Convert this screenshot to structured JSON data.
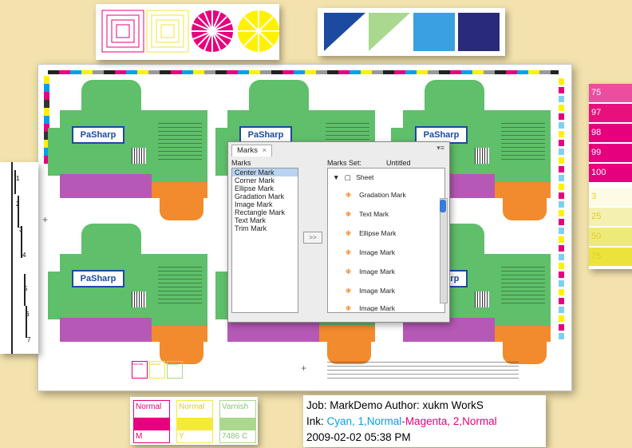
{
  "sheet": {
    "logo_text": "PaSharp",
    "bottom_legend_small": [
      "Normal",
      "Normal",
      "Varnish"
    ]
  },
  "dialog": {
    "tab_label": "Marks",
    "close_glyph": "×",
    "marks_label": "Marks",
    "marks_set_label": "Marks Set:",
    "marks_set_value": "Untitled",
    "move_button": ">>",
    "marks_items": [
      "Center Mark",
      "Corner Mark",
      "Ellipse Mark",
      "Gradation Mark",
      "Image Mark",
      "Rectangle Mark",
      "Text Mark",
      "Trim Mark"
    ],
    "selected_index": 0,
    "tree_root": "Sheet",
    "set_items": [
      "Gradation Mark",
      "Text Mark",
      "Ellipse Mark",
      "Image Mark",
      "Image Mark",
      "Image Mark",
      "Image Mark"
    ]
  },
  "callout_right": {
    "cells": [
      {
        "text": "75",
        "bg": "#ec4d9e",
        "fg": "#ffffff"
      },
      {
        "text": "97",
        "bg": "#e8107d",
        "fg": "#ffffff"
      },
      {
        "text": "98",
        "bg": "#e6007e",
        "fg": "#ffffff"
      },
      {
        "text": "99",
        "bg": "#e6007e",
        "fg": "#ffffff"
      },
      {
        "text": "100",
        "bg": "#e6007e",
        "fg": "#ffffff"
      },
      {
        "text": "3",
        "bg": "#fdfbe6",
        "fg": "#e9d21a"
      },
      {
        "text": "25",
        "bg": "#f4f0b0",
        "fg": "#e0cc2a"
      },
      {
        "text": "50",
        "bg": "#eeea7a",
        "fg": "#e0cc2a"
      },
      {
        "text": "75",
        "bg": "#ece33a",
        "fg": "#e0cc2a"
      }
    ]
  },
  "ruler_callout": {
    "labels": [
      "1",
      "2",
      "3",
      "4",
      "5",
      "6",
      "7"
    ]
  },
  "legend": {
    "cells": [
      {
        "label": "Normal",
        "bottom": "M",
        "color": "#e6007e"
      },
      {
        "label": "Normal",
        "bottom": "Y",
        "color": "#f5ea3a"
      },
      {
        "label": "Varnish",
        "bottom": "7486 C",
        "color": "#a9d88e"
      }
    ]
  },
  "info": {
    "line1": "Job: MarkDemo  Author: xukm  WorkS",
    "ink_label": "Ink: ",
    "ink_cyan": "Cyan, 1,Normal",
    "ink_sep": "-",
    "ink_magenta": "Magenta, 2,Normal",
    "line3": "2009-02-02 05:38 PM"
  },
  "colors": {
    "magenta": "#e6007e",
    "cyan": "#00a0e9",
    "yellow": "#fff100",
    "box_green": "#5fbf6a",
    "box_orange": "#f28a2e",
    "navy": "#1b4aa0"
  }
}
